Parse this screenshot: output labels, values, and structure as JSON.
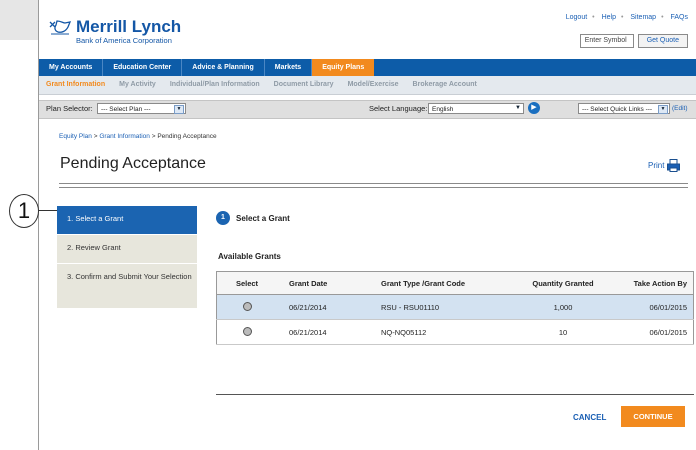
{
  "brand": {
    "name": "Merrill Lynch",
    "subtitle": "Bank of America Corporation",
    "color": "#1457a6"
  },
  "utility_links": [
    "Logout",
    "Help",
    "Sitemap",
    "FAQs"
  ],
  "symbol_search": {
    "placeholder": "Enter Symbol",
    "button": "Get Quote"
  },
  "main_nav": [
    {
      "label": "My Accounts"
    },
    {
      "label": "Education Center"
    },
    {
      "label": "Advice & Planning"
    },
    {
      "label": "Markets"
    },
    {
      "label": "Equity Plans",
      "active": true
    }
  ],
  "sub_nav": [
    {
      "label": "Grant Information",
      "active": true
    },
    {
      "label": "My Activity"
    },
    {
      "label": "Individual/Plan Information"
    },
    {
      "label": "Document Library"
    },
    {
      "label": "Model/Exercise"
    },
    {
      "label": "Brokerage Account"
    }
  ],
  "toolbar": {
    "plan_selector_label": "Plan Selector:",
    "plan_selector_value": "--- Select Plan ---",
    "language_label": "Select Language:",
    "language_value": "English",
    "quick_links_value": "--- Select Quick Links ---",
    "edit_label": "(Edit)"
  },
  "breadcrumb": {
    "items": [
      "Equity Plan",
      "Grant Information",
      "Pending Acceptance"
    ]
  },
  "page_title": "Pending Acceptance",
  "print_label": "Print",
  "callout_number": "1",
  "steps": [
    {
      "label": "1. Select a Grant",
      "active": true
    },
    {
      "label": "2. Review Grant"
    },
    {
      "label": "3. Confirm and Submit Your Selection"
    }
  ],
  "section": {
    "number": "1",
    "title": "Select a Grant"
  },
  "available_grants_label": "Available Grants",
  "table": {
    "headers": [
      "Select",
      "Grant Date",
      "Grant Type /Grant Code",
      "Quantity Granted",
      "Take Action By"
    ],
    "rows": [
      {
        "grant_date": "06/21/2014",
        "grant_type": "RSU - RSU01110",
        "quantity": "1,000",
        "take_action_by": "06/01/2015",
        "selected": true
      },
      {
        "grant_date": "06/21/2014",
        "grant_type": "NQ-NQ05112",
        "quantity": "10",
        "take_action_by": "06/01/2015",
        "selected": false
      }
    ]
  },
  "actions": {
    "cancel": "CANCEL",
    "continue": "CONTINUE"
  },
  "colors": {
    "nav_blue": "#0d5ca8",
    "accent_orange": "#f28a1e",
    "selected_row": "#d3e2f1"
  }
}
